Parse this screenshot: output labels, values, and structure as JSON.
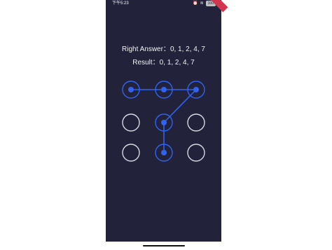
{
  "status": {
    "time": "下午5:23",
    "icons": [
      "alarm-icon",
      "wifi-icon",
      "battery-icon"
    ],
    "battery_label": "100"
  },
  "answer": {
    "label": "Right Answer：",
    "sequence": "0, 1, 2, 4, 7"
  },
  "result": {
    "label": "Result：",
    "sequence": "0, 1, 2, 4, 7"
  },
  "pattern": {
    "rows": 3,
    "cols": 3,
    "selected_path": [
      0,
      1,
      2,
      4,
      7
    ],
    "colors": {
      "background": "#22223a",
      "active": "#2f63f0",
      "inactive_ring": "#d8d8e0"
    }
  }
}
